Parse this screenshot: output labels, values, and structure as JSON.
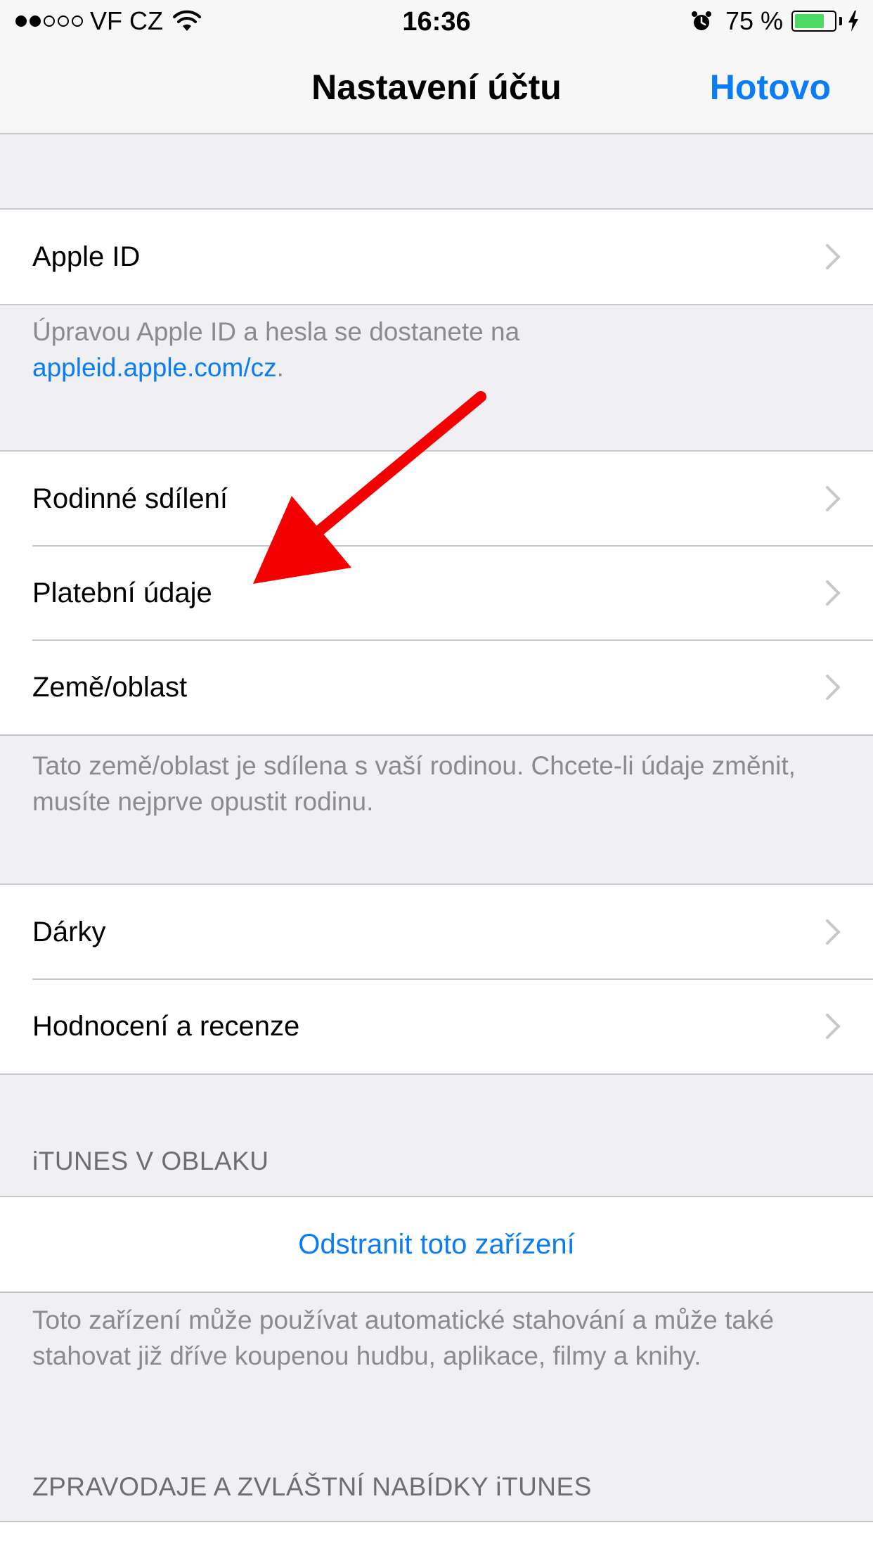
{
  "status_bar": {
    "carrier": "VF CZ",
    "signal_bars_filled": 2,
    "signal_bars_total": 5,
    "time": "16:36",
    "battery_percent": "75 %",
    "battery_level": 0.75,
    "battery_color": "#4cd964"
  },
  "nav": {
    "title": "Nastavení účtu",
    "done_label": "Hotovo"
  },
  "groups": {
    "apple_id": {
      "items": [
        {
          "label": "Apple ID"
        }
      ],
      "footer_text": "Úpravou Apple ID a hesla se dostanete na",
      "footer_link": "appleid.apple.com/cz",
      "footer_link_suffix": "."
    },
    "family": {
      "items": [
        {
          "label": "Rodinné sdílení"
        },
        {
          "label": "Platební údaje"
        },
        {
          "label": "Země/oblast"
        }
      ],
      "footer_text": "Tato země/oblast je sdílena s vaší rodinou. Chcete-li údaje změnit, musíte nejprve opustit rodinu."
    },
    "gifts": {
      "items": [
        {
          "label": "Dárky"
        },
        {
          "label": "Hodnocení a recenze"
        }
      ]
    },
    "itunes_cloud": {
      "header": "iTUNES V OBLAKU",
      "action_label": "Odstranit toto zařízení",
      "footer_text": "Toto zařízení může používat automatické stahování a může také stahovat již dříve koupenou hudbu, aplikace, filmy a knihy."
    },
    "newsletter": {
      "header": "ZPRAVODAJE A ZVLÁŠTNÍ NABÍDKY iTUNES"
    }
  },
  "colors": {
    "accent": "#0a7cf5",
    "annotation_arrow": "#f40000"
  },
  "icons": {
    "row_disclosure": "chevron-right-icon",
    "wifi": "wifi-icon",
    "alarm": "alarm-icon",
    "charging": "bolt-icon"
  }
}
